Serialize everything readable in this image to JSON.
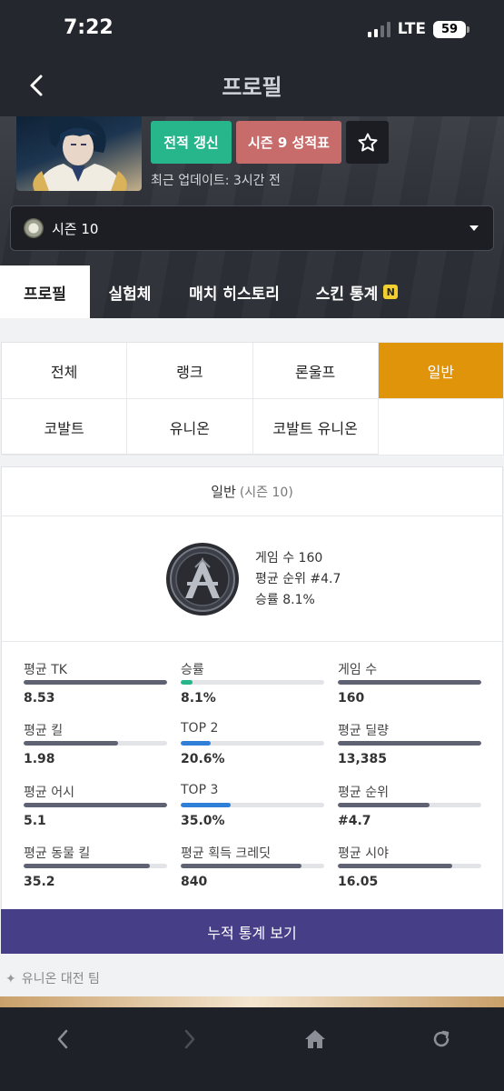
{
  "status_bar": {
    "time": "7:22",
    "network": "LTE",
    "battery": "59"
  },
  "header": {
    "title": "프로필"
  },
  "hero": {
    "refresh_label": "전적 갱신",
    "report_label": "시즌 9 성적표",
    "updated_text": "최근 업데이트: 3시간 전",
    "season_selected": "시즌 10"
  },
  "tabs": [
    {
      "label": "프로필",
      "active": true
    },
    {
      "label": "실험체",
      "active": false
    },
    {
      "label": "매치 히스토리",
      "active": false
    },
    {
      "label": "스킨 통계",
      "active": false,
      "badge": "N"
    }
  ],
  "modes": [
    {
      "label": "전체",
      "active": false
    },
    {
      "label": "랭크",
      "active": false
    },
    {
      "label": "론울프",
      "active": false
    },
    {
      "label": "일반",
      "active": true
    },
    {
      "label": "코발트",
      "active": false
    },
    {
      "label": "유니온",
      "active": false
    },
    {
      "label": "코발트 유니온",
      "active": false
    }
  ],
  "card": {
    "title": "일반",
    "subtitle": "(시즌 10)",
    "summary": {
      "games": "게임 수 160",
      "avg_rank": "평균 순위 #4.7",
      "winrate": "승률 8.1%"
    },
    "stats": [
      {
        "label": "평균 TK",
        "value": "8.53",
        "fill": 1.0,
        "color": "#5e6272"
      },
      {
        "label": "승률",
        "value": "8.1%",
        "fill": 0.081,
        "color": "#26b58a"
      },
      {
        "label": "게임 수",
        "value": "160",
        "fill": 1.0,
        "color": "#5e6272"
      },
      {
        "label": "평균 킬",
        "value": "1.98",
        "fill": 0.66,
        "color": "#5e6272"
      },
      {
        "label": "TOP 2",
        "value": "20.6%",
        "fill": 0.206,
        "color": "#2f7fd8"
      },
      {
        "label": "평균 딜량",
        "value": "13,385",
        "fill": 1.0,
        "color": "#5e6272"
      },
      {
        "label": "평균 어시",
        "value": "5.1",
        "fill": 1.0,
        "color": "#5e6272"
      },
      {
        "label": "TOP 3",
        "value": "35.0%",
        "fill": 0.35,
        "color": "#2f7fd8"
      },
      {
        "label": "평균 순위",
        "value": "#4.7",
        "fill": 0.64,
        "color": "#5e6272"
      },
      {
        "label": "평균 동물 킬",
        "value": "35.2",
        "fill": 0.88,
        "color": "#5e6272"
      },
      {
        "label": "평균 획득 크레딧",
        "value": "840",
        "fill": 0.84,
        "color": "#5e6272"
      },
      {
        "label": "평균 시야",
        "value": "16.05",
        "fill": 0.8,
        "color": "#5e6272"
      }
    ]
  },
  "cumulative_button": "누적 통계 보기",
  "union_section_title": "유니온 대전 팀",
  "colors": {
    "accent_orange": "#e0940a",
    "green": "#27b68c",
    "red": "#c86b6b",
    "purple": "#463e86"
  }
}
